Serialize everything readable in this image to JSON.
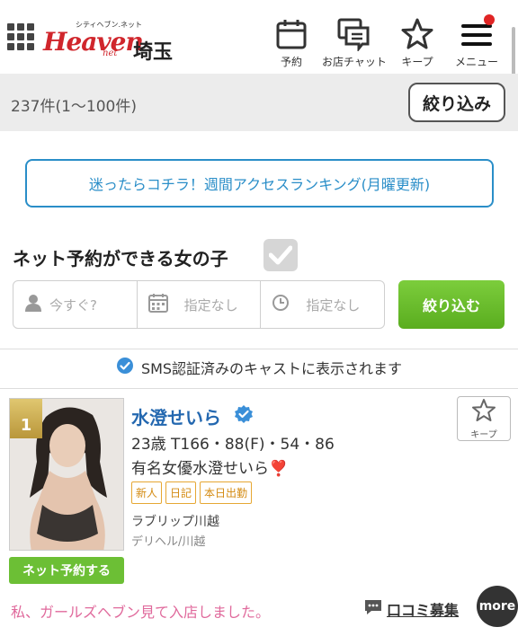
{
  "header": {
    "logo_sub": "シティヘブン.ネット",
    "logo_main": "Heaven",
    "logo_net": "net",
    "region": "埼玉",
    "nav": [
      {
        "label": "予約",
        "icon": "calendar-icon"
      },
      {
        "label": "お店チャット",
        "icon": "chat-icon"
      },
      {
        "label": "キープ",
        "icon": "star-icon"
      },
      {
        "label": "メニュー",
        "icon": "menu-icon"
      }
    ]
  },
  "results": {
    "count": "237件(1〜100件)",
    "filter_label": "絞り込み"
  },
  "ranking_banner": "迷ったらコチラ！週間アクセスランキング(月曜更新)",
  "net_reserve": {
    "title": "ネット予約ができる女の子",
    "fields": [
      {
        "placeholder": "今すぐ?",
        "icon": "person-icon"
      },
      {
        "placeholder": "指定なし",
        "icon": "calendar-icon"
      },
      {
        "placeholder": "指定なし",
        "icon": "clock-icon"
      }
    ],
    "search_label": "絞り込む"
  },
  "sms_note": "SMS認証済みのキャストに表示されます",
  "cast": {
    "rank": "1",
    "name": "水澄せいら",
    "stats": "23歳 T166・88(F)・54・86",
    "catch": "有名女優水澄せいら❣️",
    "tags": [
      "新人",
      "日記",
      "本日出勤"
    ],
    "shop": "ラブリップ川越",
    "genre": "デリヘル/川越",
    "keep_label": "キープ",
    "reserve_label": "ネット予約する",
    "message": "私、ガールズヘブン見て入店しました。",
    "review_label": "口コミ募集",
    "more_label": "more"
  },
  "colors": {
    "brand_red": "#d0262c",
    "link_blue": "#2a8ec8",
    "name_blue": "#2468b0",
    "green": "#6cbf35",
    "tag_orange": "#e6a733",
    "pink": "#e06a9c"
  }
}
